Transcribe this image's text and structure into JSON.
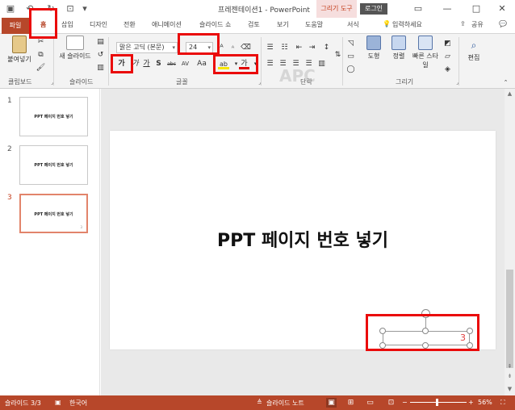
{
  "app": {
    "title": "프레젠테이션1 - PowerPoint",
    "contextual_tab": "그리기 도구",
    "login": "로그인",
    "window_controls": [
      "—",
      "□",
      "✕"
    ]
  },
  "tabs": {
    "file": "파일",
    "items": [
      "홈",
      "삽입",
      "디자인",
      "전환",
      "애니메이션",
      "슬라이드 쇼",
      "검토",
      "보기",
      "도움말",
      "서식"
    ],
    "active": "홈",
    "tell_me": "입력하세요",
    "share": "공유"
  },
  "ribbon": {
    "clipboard": {
      "paste": "붙여넣기",
      "label": "클립보드"
    },
    "slides": {
      "new_slide": "새 슬라이드",
      "label": "슬라이드"
    },
    "font": {
      "name": "맑은 고딕 (본문)",
      "size": "24",
      "label": "글꼴",
      "buttons": [
        "가",
        "가",
        "가",
        "S",
        "abc",
        "AV",
        "Aa"
      ],
      "highlight_icon": "ab",
      "font_color_icon": "가"
    },
    "paragraph": {
      "label": "단락"
    },
    "drawing": {
      "shape": "도형",
      "arrange": "정렬",
      "quick_styles": "빠른 스타일",
      "label": "그리기"
    },
    "editing": {
      "edit": "편집"
    }
  },
  "slides": [
    {
      "number": "1",
      "title": "PPT 페이지 번호 넣기",
      "active": false
    },
    {
      "number": "2",
      "title": "PPT 페이지 번호 넣기",
      "active": false
    },
    {
      "number": "3",
      "title": "PPT 페이지 번호 넣기",
      "active": true
    }
  ],
  "current_slide": {
    "title": "PPT 페이지 번호 넣기",
    "page_number": "3"
  },
  "status": {
    "slide_info": "슬라이드 3/3",
    "language": "한국어",
    "notes": "슬라이드 노트",
    "zoom": "56%"
  },
  "colors": {
    "accent": "#b7472a",
    "highlight_box": "#ea0a0a"
  }
}
